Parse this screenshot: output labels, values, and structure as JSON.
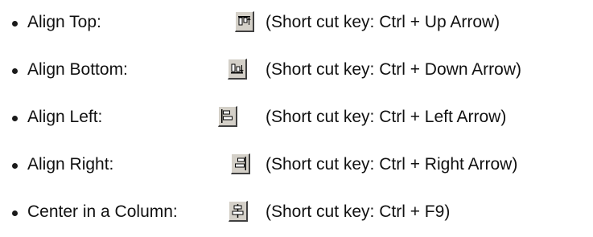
{
  "alignment_items": [
    {
      "label": "Align Top:",
      "icon": "align-top-icon",
      "shortcut": "(Short cut key: Ctrl + Up Arrow)"
    },
    {
      "label": "Align Bottom:",
      "icon": "align-bottom-icon",
      "shortcut": "(Short cut key: Ctrl + Down Arrow)"
    },
    {
      "label": "Align Left:",
      "icon": "align-left-icon",
      "shortcut": "(Short cut key: Ctrl + Left Arrow)"
    },
    {
      "label": "Align Right:",
      "icon": "align-right-icon",
      "shortcut": "(Short cut key: Ctrl + Right Arrow)"
    },
    {
      "label": "Center in a Column:",
      "icon": "center-in-column-icon",
      "shortcut": "(Short cut key: Ctrl + F9)"
    }
  ]
}
